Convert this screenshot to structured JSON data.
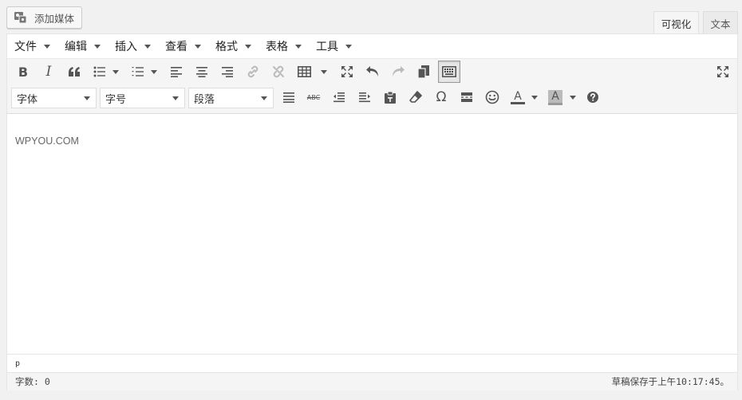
{
  "add_media": {
    "label": "添加媒体"
  },
  "tabs": {
    "visual": "可视化",
    "text": "文本"
  },
  "menubar": {
    "items": [
      {
        "label": "文件"
      },
      {
        "label": "编辑"
      },
      {
        "label": "插入"
      },
      {
        "label": "查看"
      },
      {
        "label": "格式"
      },
      {
        "label": "表格"
      },
      {
        "label": "工具"
      }
    ]
  },
  "toolbar": {
    "font_family": "字体",
    "font_size": "字号",
    "format": "段落",
    "text_color_glyph": "A",
    "bg_color_glyph": "A",
    "bold_glyph": "B",
    "italic_glyph": "I",
    "strike_glyph": "ABC",
    "special_char_glyph": "Ω",
    "text_color": "#555555",
    "bg_color": "#bbbbbb"
  },
  "content": {
    "text": "WPYOU.COM"
  },
  "path": {
    "text": "p"
  },
  "status": {
    "word_count": "字数: 0",
    "draft_saved": "草稿保存于上午10:17:45。"
  }
}
